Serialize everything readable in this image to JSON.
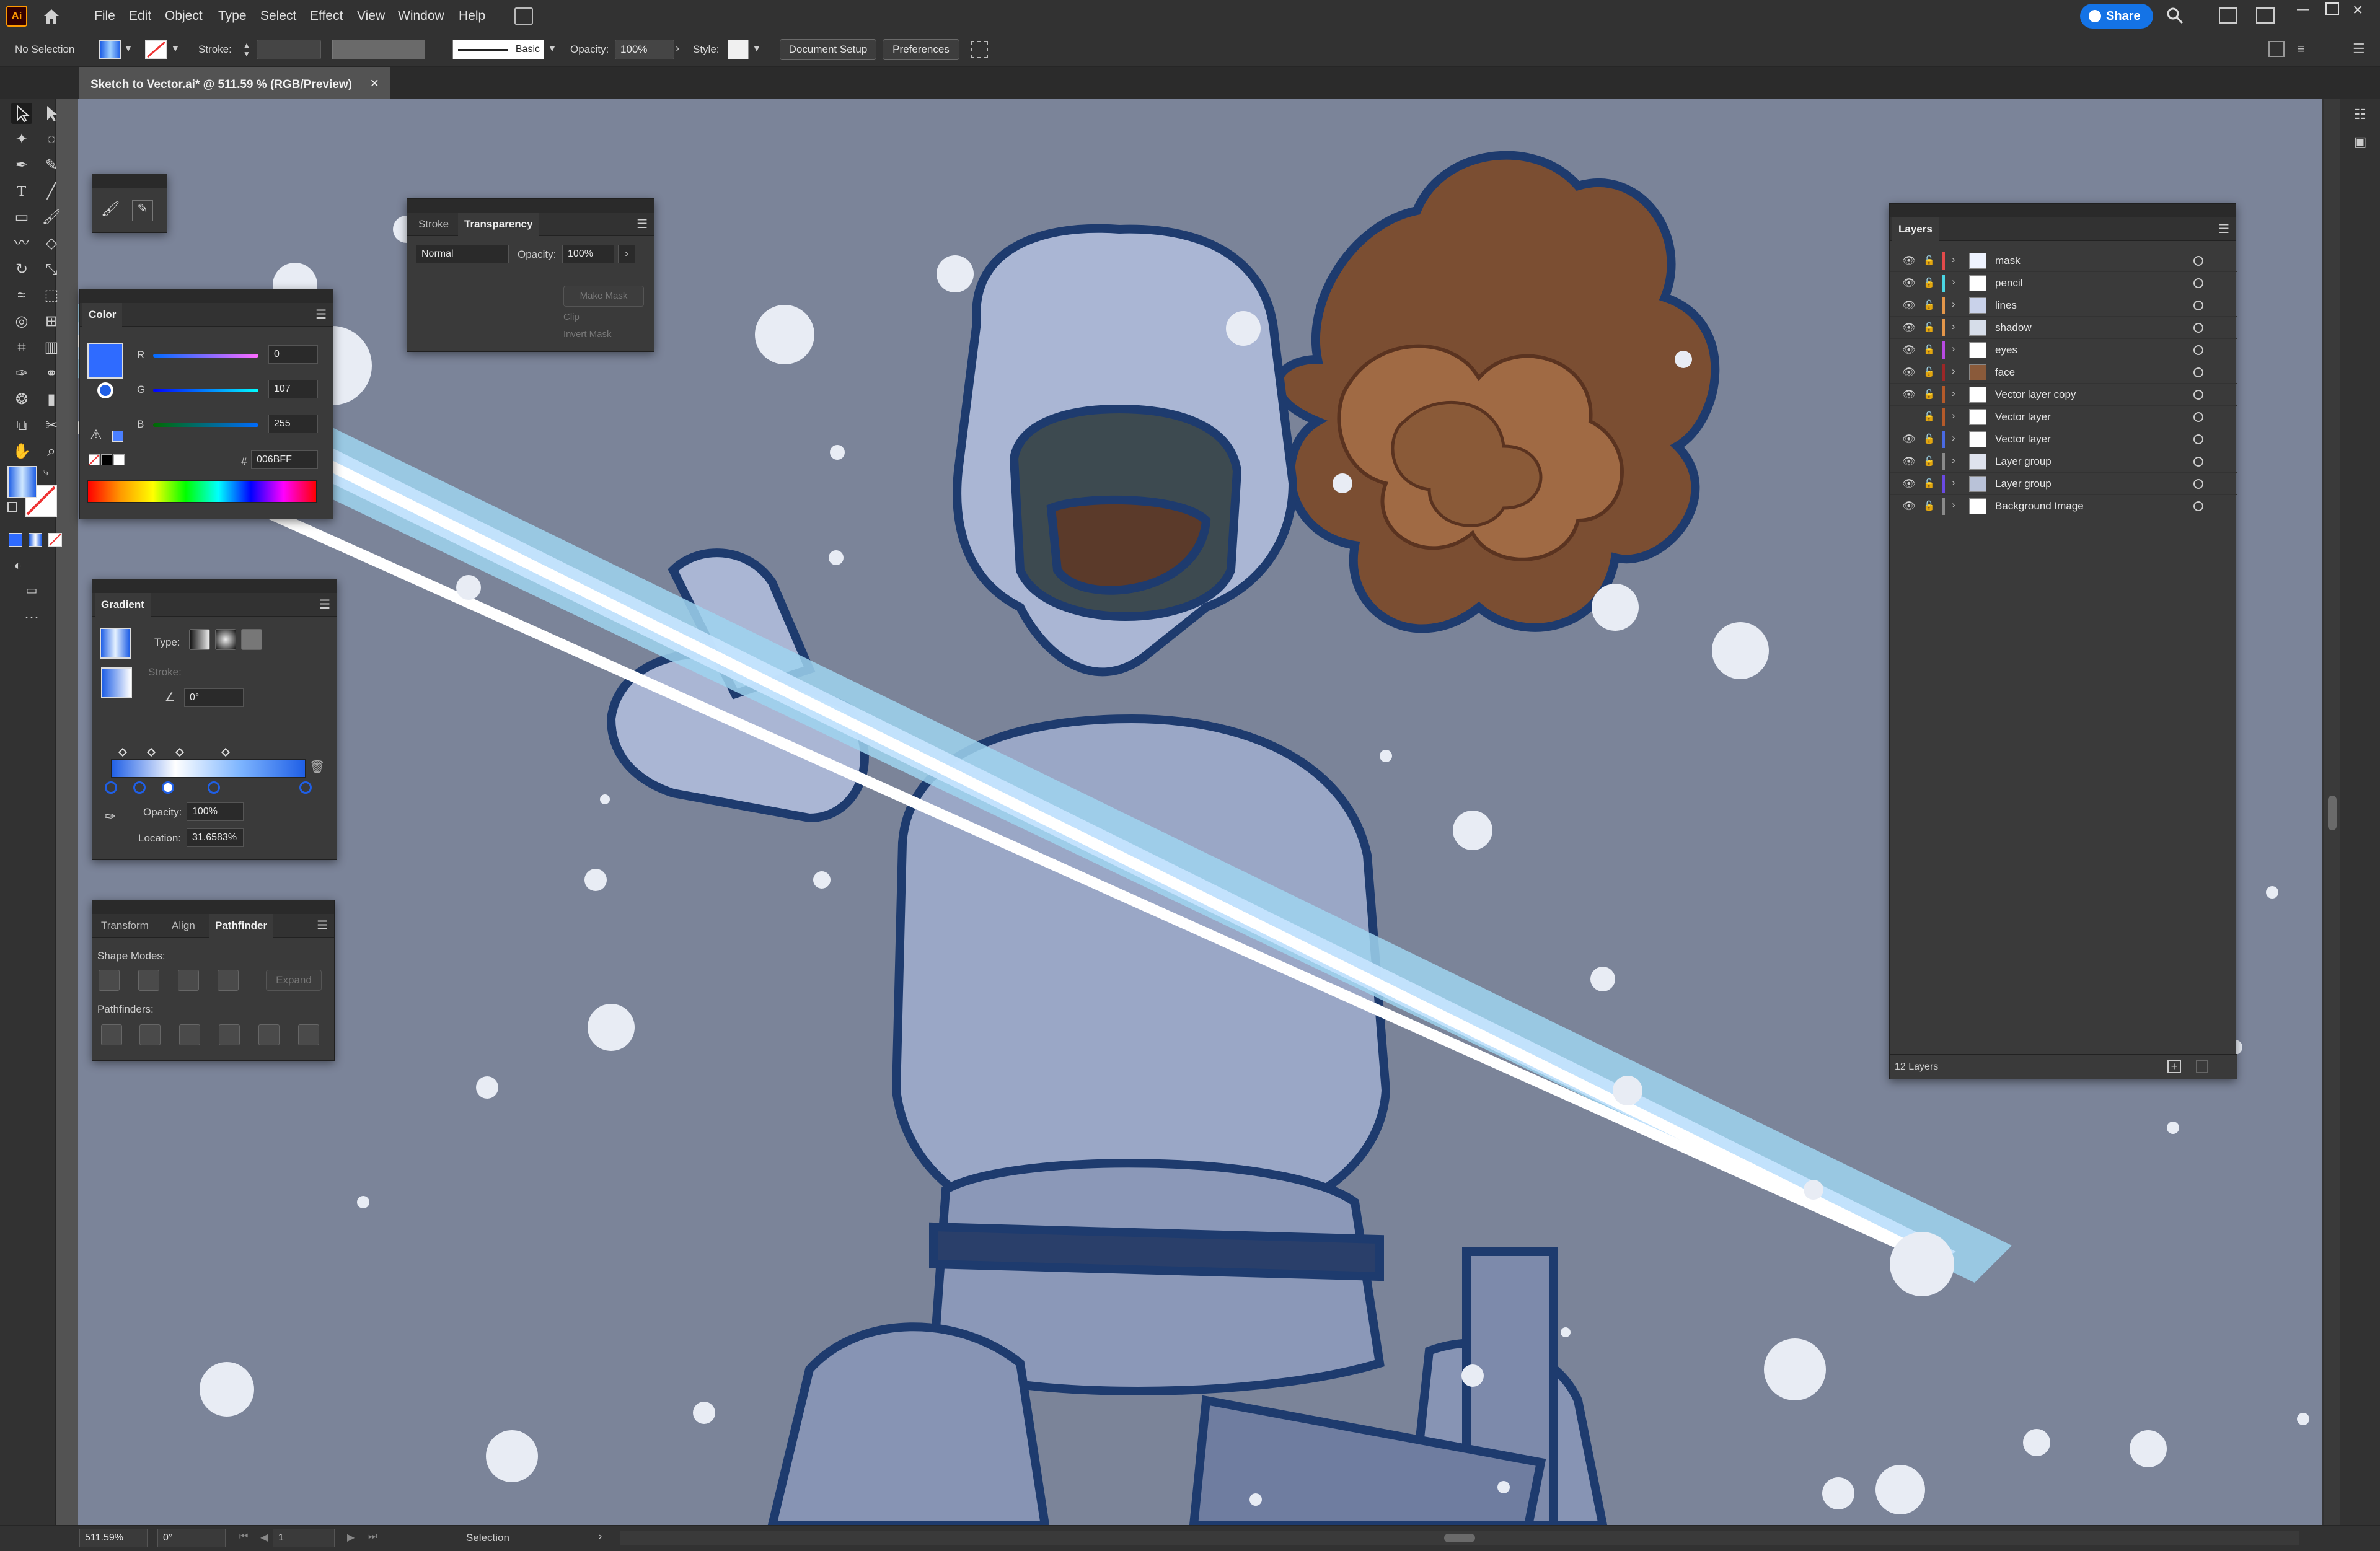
{
  "app": {
    "logo": "Ai"
  },
  "menubar": {
    "items": [
      "File",
      "Edit",
      "Object",
      "Type",
      "Select",
      "Effect",
      "View",
      "Window",
      "Help"
    ],
    "share_label": "Share"
  },
  "control": {
    "selection": "No Selection",
    "stroke_label": "Stroke:",
    "brush_label": "Basic",
    "opacity_label": "Opacity:",
    "opacity_value": "100%",
    "style_label": "Style:",
    "doc_setup": "Document Setup",
    "preferences": "Preferences"
  },
  "doc_tab": {
    "title": "Sketch to Vector.ai* @ 511.59 % (RGB/Preview)",
    "close": "×"
  },
  "transparency_panel": {
    "tabs": [
      "Stroke",
      "Transparency"
    ],
    "blend_mode": "Normal",
    "opacity_label": "Opacity:",
    "opacity_value": "100%",
    "make_mask": "Make Mask",
    "clip": "Clip",
    "invert_mask": "Invert Mask"
  },
  "color_panel": {
    "title": "Color",
    "r_label": "R",
    "r_value": "0",
    "g_label": "G",
    "g_value": "107",
    "b_label": "B",
    "b_value": "255",
    "hex_label": "#",
    "hex_value": "006BFF",
    "swatch_color": "#2f6bff"
  },
  "gradient_panel": {
    "title": "Gradient",
    "type_label": "Type:",
    "stroke_label": "Stroke:",
    "angle_value": "0°",
    "opacity_label": "Opacity:",
    "opacity_value": "100%",
    "location_label": "Location:",
    "location_value": "31.6583%"
  },
  "pathfinder_panel": {
    "tabs": [
      "Transform",
      "Align",
      "Pathfinder"
    ],
    "shape_modes_label": "Shape Modes:",
    "expand_label": "Expand",
    "pathfinders_label": "Pathfinders:"
  },
  "layers_panel": {
    "title": "Layers",
    "count": "12 Layers",
    "layers": [
      {
        "name": "mask",
        "color": "#e34a4a",
        "visible": true,
        "thumb": "#eef3ff"
      },
      {
        "name": "pencil",
        "color": "#4ad6e3",
        "visible": true,
        "thumb": "#ffffff"
      },
      {
        "name": "lines",
        "color": "#e3964a",
        "visible": true,
        "thumb": "#c9d2ea"
      },
      {
        "name": "shadow",
        "color": "#e3964a",
        "visible": true,
        "thumb": "#d6dde9"
      },
      {
        "name": "eyes",
        "color": "#b84ae3",
        "visible": true,
        "thumb": "#ffffff"
      },
      {
        "name": "face",
        "color": "#9c2727",
        "visible": true,
        "thumb": "#8a5a3a"
      },
      {
        "name": "Vector layer copy",
        "color": "#b45a2a",
        "visible": true,
        "thumb": "#ffffff"
      },
      {
        "name": "Vector layer",
        "color": "#b45a2a",
        "visible": false,
        "thumb": "#ffffff"
      },
      {
        "name": "Vector layer",
        "color": "#4a6ae3",
        "visible": true,
        "thumb": "#ffffff"
      },
      {
        "name": "Layer group",
        "color": "#8a8a8a",
        "visible": true,
        "thumb": "#dfe3ee"
      },
      {
        "name": "Layer group",
        "color": "#6a4ae3",
        "visible": true,
        "thumb": "#b9c2d8"
      },
      {
        "name": "Background Image",
        "color": "#8a8a8a",
        "visible": true,
        "thumb": "#ffffff"
      }
    ]
  },
  "status": {
    "zoom": "511.59%",
    "rotation": "0°",
    "artboard": "1",
    "tool": "Selection"
  }
}
